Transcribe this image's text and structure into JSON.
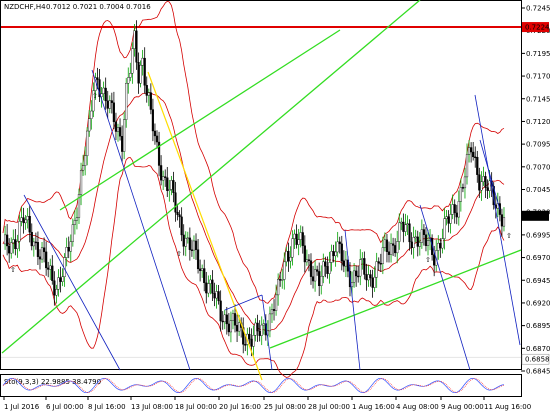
{
  "header": {
    "symbol_timeframe": "NZDCHF,H4",
    "ohlc": "0.7012 0.7021 0.7004 0.7016"
  },
  "price_axis": {
    "ticks": [
      "0.7245",
      "0.7220",
      "0.7195",
      "0.7170",
      "0.7145",
      "0.7120",
      "0.7095",
      "0.7070",
      "0.7045",
      "0.7020",
      "0.6995",
      "0.6970",
      "0.6945",
      "0.6920",
      "0.6895",
      "0.6870",
      "0.6845"
    ],
    "current_price": "0.7016",
    "hline_red_label": "0.7224",
    "hline_white_label": "0.6858"
  },
  "time_axis": {
    "ticks": [
      "1 Jul 2016",
      "6 Jul 00:00",
      "8 Jul 16:00",
      "13 Jul 08:00",
      "18 Jul 00:00",
      "20 Jul 16:00",
      "25 Jul 08:00",
      "28 Jul 00:00",
      "1 Aug 16:00",
      "4 Aug 08:00",
      "9 Aug 00:00",
      "11 Aug 16:00"
    ]
  },
  "indicator": {
    "label": "Sto(9,3,3) 22.9885 38.4790"
  },
  "colors": {
    "candle_up": "#000000",
    "candle_down": "#000000",
    "candle_body_up": "#ffffff",
    "candle_body_down": "#000000",
    "bull_wick_green": "#00a000",
    "bollinger": "#d40000",
    "trend_green": "#33dd22",
    "trend_blue": "#1020c0",
    "trend_yellow": "#ffdd00",
    "hline_red": "#e00000",
    "sto_main": "#3050ff",
    "sto_signal": "#ff2020"
  }
}
